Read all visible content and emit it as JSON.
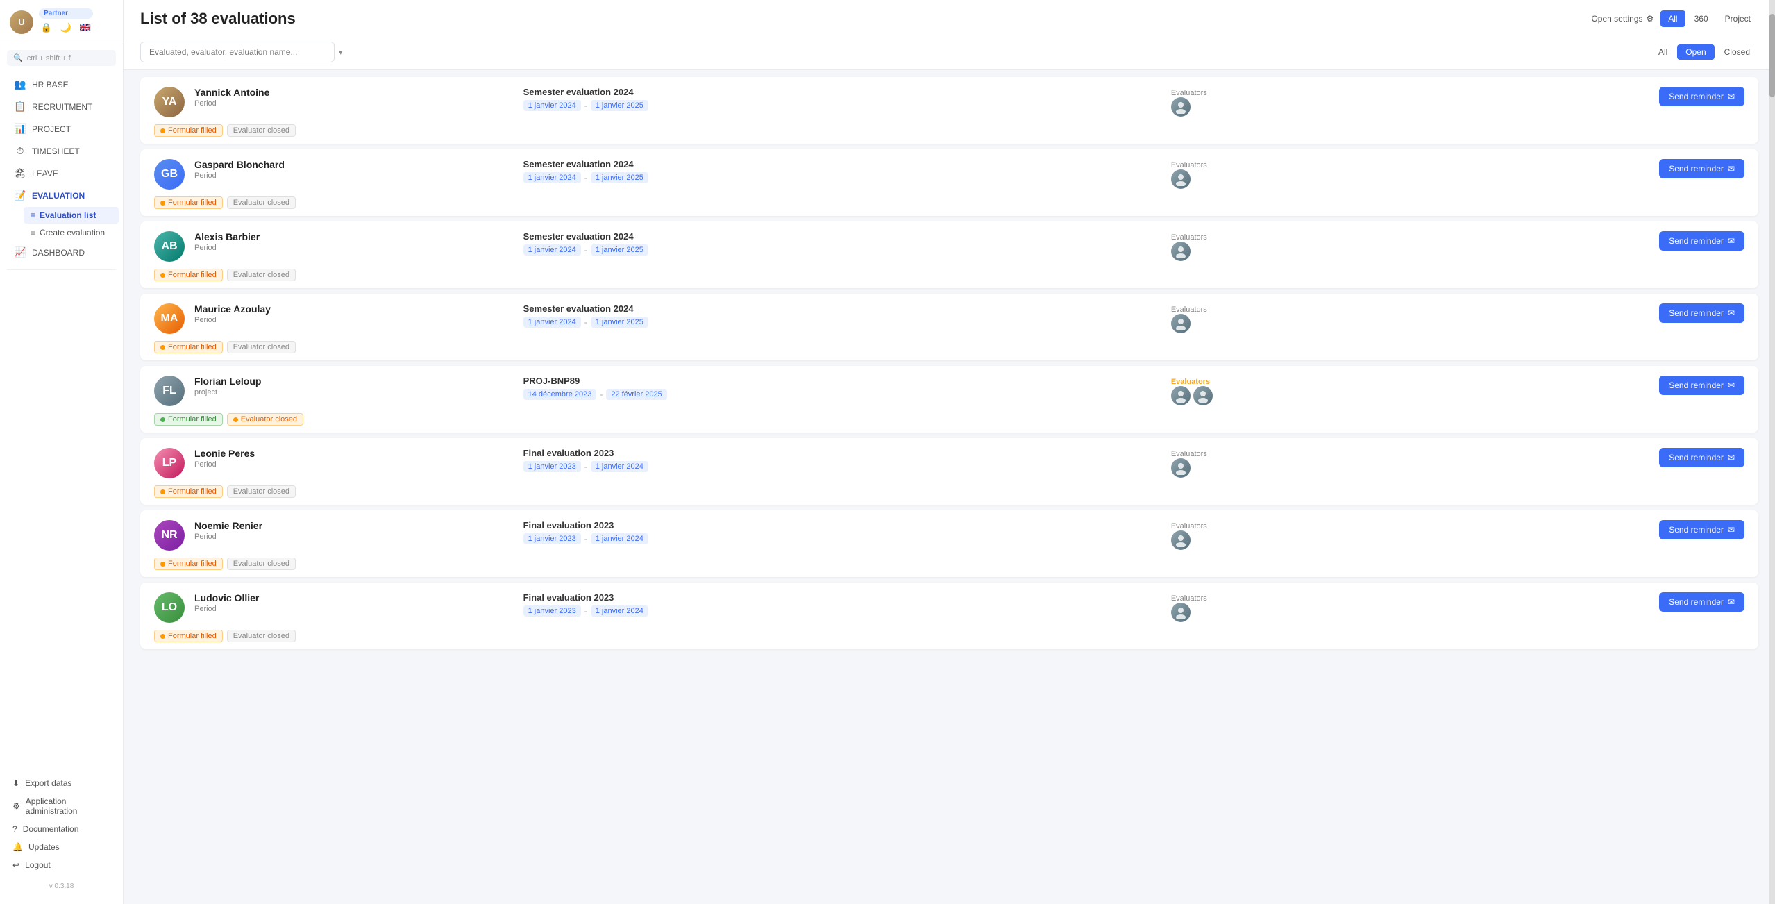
{
  "sidebar": {
    "user": {
      "initials": "U",
      "badge": "Partner"
    },
    "search_placeholder": "ctrl + shift + f",
    "nav_items": [
      {
        "id": "hr-base",
        "label": "HR BASE",
        "icon": "👥"
      },
      {
        "id": "recruitment",
        "label": "RECRUITMENT",
        "icon": "📋"
      },
      {
        "id": "project",
        "label": "PROJECT",
        "icon": "📊"
      },
      {
        "id": "timesheet",
        "label": "TIMESHEET",
        "icon": "⏱"
      },
      {
        "id": "leave",
        "label": "LEAVE",
        "icon": "🏖"
      },
      {
        "id": "evaluation",
        "label": "EVALUATION",
        "icon": "📝",
        "active": true
      },
      {
        "id": "dashboard",
        "label": "DASHBOARD",
        "icon": "📈"
      }
    ],
    "sub_items": [
      {
        "id": "evaluation-list",
        "label": "Evaluation list",
        "active": true
      },
      {
        "id": "create-evaluation",
        "label": "Create evaluation"
      }
    ],
    "bottom_items": [
      {
        "id": "export-datas",
        "label": "Export datas",
        "icon": "⬇"
      },
      {
        "id": "app-admin",
        "label": "Application administration",
        "icon": "⚙"
      },
      {
        "id": "documentation",
        "label": "Documentation",
        "icon": "?"
      },
      {
        "id": "updates",
        "label": "Updates",
        "icon": "🔔"
      },
      {
        "id": "logout",
        "label": "Logout",
        "icon": "↩"
      }
    ],
    "version": "v 0.3.18"
  },
  "header": {
    "title": "List of 38 evaluations",
    "open_settings_label": "Open settings",
    "type_tabs": [
      {
        "id": "all",
        "label": "All",
        "active": true
      },
      {
        "id": "360",
        "label": "360"
      },
      {
        "id": "project",
        "label": "Project"
      }
    ],
    "filter_placeholder": "Evaluated, evaluator, evaluation name...",
    "status_tabs": [
      {
        "id": "all",
        "label": "All"
      },
      {
        "id": "open",
        "label": "Open",
        "active": true
      },
      {
        "id": "closed",
        "label": "Closed"
      }
    ]
  },
  "evaluations": [
    {
      "id": 1,
      "name": "Yannick Antoine",
      "type": "Period",
      "eval_name": "Semester evaluation 2024",
      "date_start": "1 janvier 2024",
      "date_end": "1 janvier 2025",
      "evaluators_label": "Evaluators",
      "evaluators_highlighted": false,
      "num_evaluators": 1,
      "badges": [
        {
          "type": "orange",
          "dot": true,
          "text": "Formular filled"
        },
        {
          "type": "grey",
          "dot": false,
          "text": "Evaluator closed"
        }
      ],
      "send_reminder": "Send reminder",
      "avatar_color": "av-brown"
    },
    {
      "id": 2,
      "name": "Gaspard Blonchard",
      "type": "Period",
      "eval_name": "Semester evaluation 2024",
      "date_start": "1 janvier 2024",
      "date_end": "1 janvier 2025",
      "evaluators_label": "Evaluators",
      "evaluators_highlighted": false,
      "num_evaluators": 1,
      "badges": [
        {
          "type": "orange",
          "dot": true,
          "text": "Formular filled"
        },
        {
          "type": "grey",
          "dot": false,
          "text": "Evaluator closed"
        }
      ],
      "send_reminder": "Send reminder",
      "avatar_color": "av-blue"
    },
    {
      "id": 3,
      "name": "Alexis Barbier",
      "type": "Period",
      "eval_name": "Semester evaluation 2024",
      "date_start": "1 janvier 2024",
      "date_end": "1 janvier 2025",
      "evaluators_label": "Evaluators",
      "evaluators_highlighted": false,
      "num_evaluators": 1,
      "badges": [
        {
          "type": "orange",
          "dot": true,
          "text": "Formular filled"
        },
        {
          "type": "grey",
          "dot": false,
          "text": "Evaluator closed"
        }
      ],
      "send_reminder": "Send reminder",
      "avatar_color": "av-teal"
    },
    {
      "id": 4,
      "name": "Maurice Azoulay",
      "type": "Period",
      "eval_name": "Semester evaluation 2024",
      "date_start": "1 janvier 2024",
      "date_end": "1 janvier 2025",
      "evaluators_label": "Evaluators",
      "evaluators_highlighted": false,
      "num_evaluators": 1,
      "badges": [
        {
          "type": "orange",
          "dot": true,
          "text": "Formular filled"
        },
        {
          "type": "grey",
          "dot": false,
          "text": "Evaluator closed"
        }
      ],
      "send_reminder": "Send reminder",
      "avatar_color": "av-orange"
    },
    {
      "id": 5,
      "name": "Florian Leloup",
      "type": "project",
      "eval_name": "PROJ-BNP89",
      "date_start": "14 décembre 2023",
      "date_end": "22 février 2025",
      "evaluators_label": "Evaluators",
      "evaluators_highlighted": true,
      "num_evaluators": 2,
      "badges": [
        {
          "type": "green",
          "dot": true,
          "text": "Formular filled"
        },
        {
          "type": "orange",
          "dot": true,
          "text": "Evaluator closed"
        }
      ],
      "send_reminder": "Send reminder",
      "avatar_color": "av-grey"
    },
    {
      "id": 6,
      "name": "Leonie Peres",
      "type": "Period",
      "eval_name": "Final evaluation 2023",
      "date_start": "1 janvier 2023",
      "date_end": "1 janvier 2024",
      "evaluators_label": "Evaluators",
      "evaluators_highlighted": false,
      "num_evaluators": 1,
      "badges": [
        {
          "type": "orange",
          "dot": true,
          "text": "Formular filled"
        },
        {
          "type": "grey",
          "dot": false,
          "text": "Evaluator closed"
        }
      ],
      "send_reminder": "Send reminder",
      "avatar_color": "av-pink"
    },
    {
      "id": 7,
      "name": "Noemie Renier",
      "type": "Period",
      "eval_name": "Final evaluation 2023",
      "date_start": "1 janvier 2023",
      "date_end": "1 janvier 2024",
      "evaluators_label": "Evaluators",
      "evaluators_highlighted": false,
      "num_evaluators": 1,
      "badges": [
        {
          "type": "orange",
          "dot": true,
          "text": "Formular filled"
        },
        {
          "type": "grey",
          "dot": false,
          "text": "Evaluator closed"
        }
      ],
      "send_reminder": "Send reminder",
      "avatar_color": "av-purple"
    },
    {
      "id": 8,
      "name": "Ludovic Ollier",
      "type": "Period",
      "eval_name": "Final evaluation 2023",
      "date_start": "1 janvier 2023",
      "date_end": "1 janvier 2024",
      "evaluators_label": "Evaluators",
      "evaluators_highlighted": false,
      "num_evaluators": 1,
      "badges": [
        {
          "type": "orange",
          "dot": true,
          "text": "Formular filled"
        },
        {
          "type": "grey",
          "dot": false,
          "text": "Evaluator closed"
        }
      ],
      "send_reminder": "Send reminder",
      "avatar_color": "av-green"
    }
  ]
}
